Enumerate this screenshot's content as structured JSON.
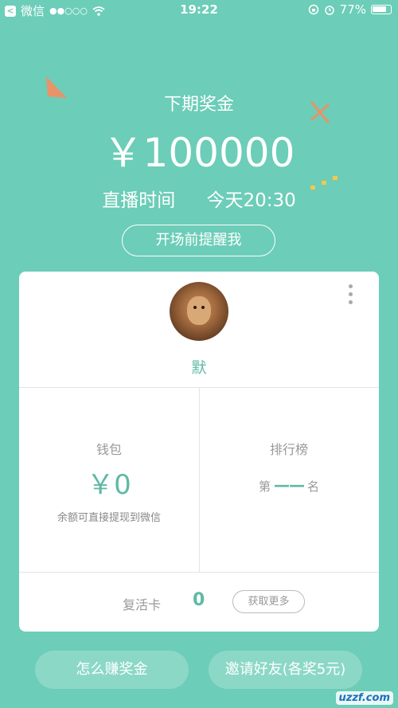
{
  "status_bar": {
    "back_app": "微信",
    "signal": "●●○○○",
    "time": "19:22",
    "battery": "77%",
    "battery_level": 0.77
  },
  "prize": {
    "label": "下期奖金",
    "amount": "￥100000"
  },
  "live": {
    "label": "直播时间",
    "time": "今天20:30"
  },
  "remind_button": "开场前提醒我",
  "profile": {
    "username": "默"
  },
  "wallet": {
    "label": "钱包",
    "amount": "￥0",
    "note": "余额可直接提现到微信"
  },
  "ranking": {
    "label": "排行榜",
    "prefix": "第",
    "value": "——",
    "suffix": "名"
  },
  "revive": {
    "label": "复活卡",
    "count": "0",
    "get_more": "获取更多"
  },
  "bottom": {
    "earn": "怎么赚奖金",
    "invite": "邀请好友(各奖5元)"
  },
  "watermark": "uzzf.com",
  "colors": {
    "background": "#6ccdb8",
    "accent": "#5fb9a5",
    "triangle": "#e8936a",
    "dots": "#f5c84c"
  }
}
